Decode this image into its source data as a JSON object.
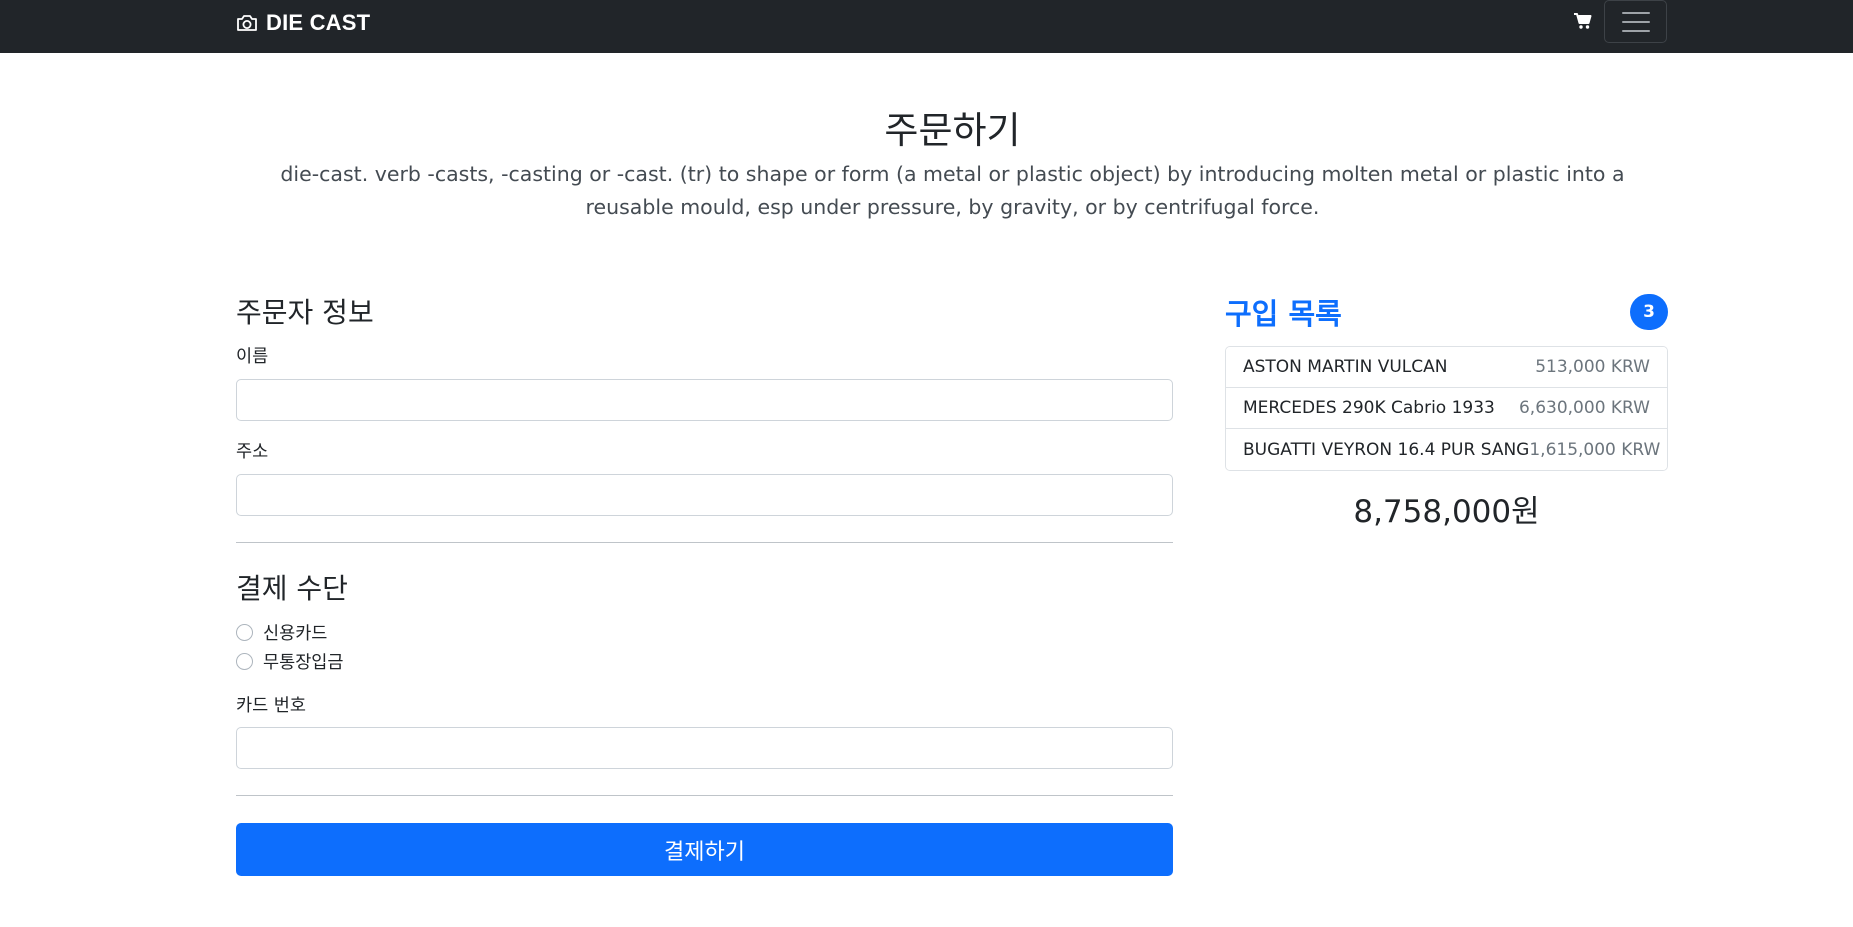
{
  "navbar": {
    "brand": "DIE CAST",
    "brand_icon": "camera-icon",
    "cart_icon": "shopping-cart-icon",
    "menu_icon": "hamburger-menu-icon",
    "background": "#212529"
  },
  "header": {
    "title": "주문하기",
    "description": "die-cast. verb -casts, -casting or -cast. (tr) to shape or form (a metal or plastic object) by introducing molten metal or plastic into a reusable mould, esp under pressure, by gravity, or by centrifugal force."
  },
  "orderer": {
    "section_title": "주문자 정보",
    "name_label": "이름",
    "name_value": "",
    "address_label": "주소",
    "address_value": ""
  },
  "payment": {
    "section_title": "결제 수단",
    "options": [
      {
        "label": "신용카드",
        "checked": false
      },
      {
        "label": "무통장입금",
        "checked": false
      }
    ],
    "card_label": "카드 번호",
    "card_value": "",
    "submit_label": "결제하기"
  },
  "cart": {
    "title": "구입 목록",
    "count": "3",
    "items": [
      {
        "name": "ASTON MARTIN VULCAN",
        "price": "513,000 KRW"
      },
      {
        "name": "MERCEDES 290K Cabrio 1933",
        "price": "6,630,000 KRW"
      },
      {
        "name": "BUGATTI VEYRON 16.4 PUR SANG",
        "price": "1,615,000 KRW"
      }
    ],
    "total": "8,758,000원"
  },
  "colors": {
    "primary": "#0d6efd",
    "navbar": "#212529",
    "muted": "#6c757d"
  }
}
